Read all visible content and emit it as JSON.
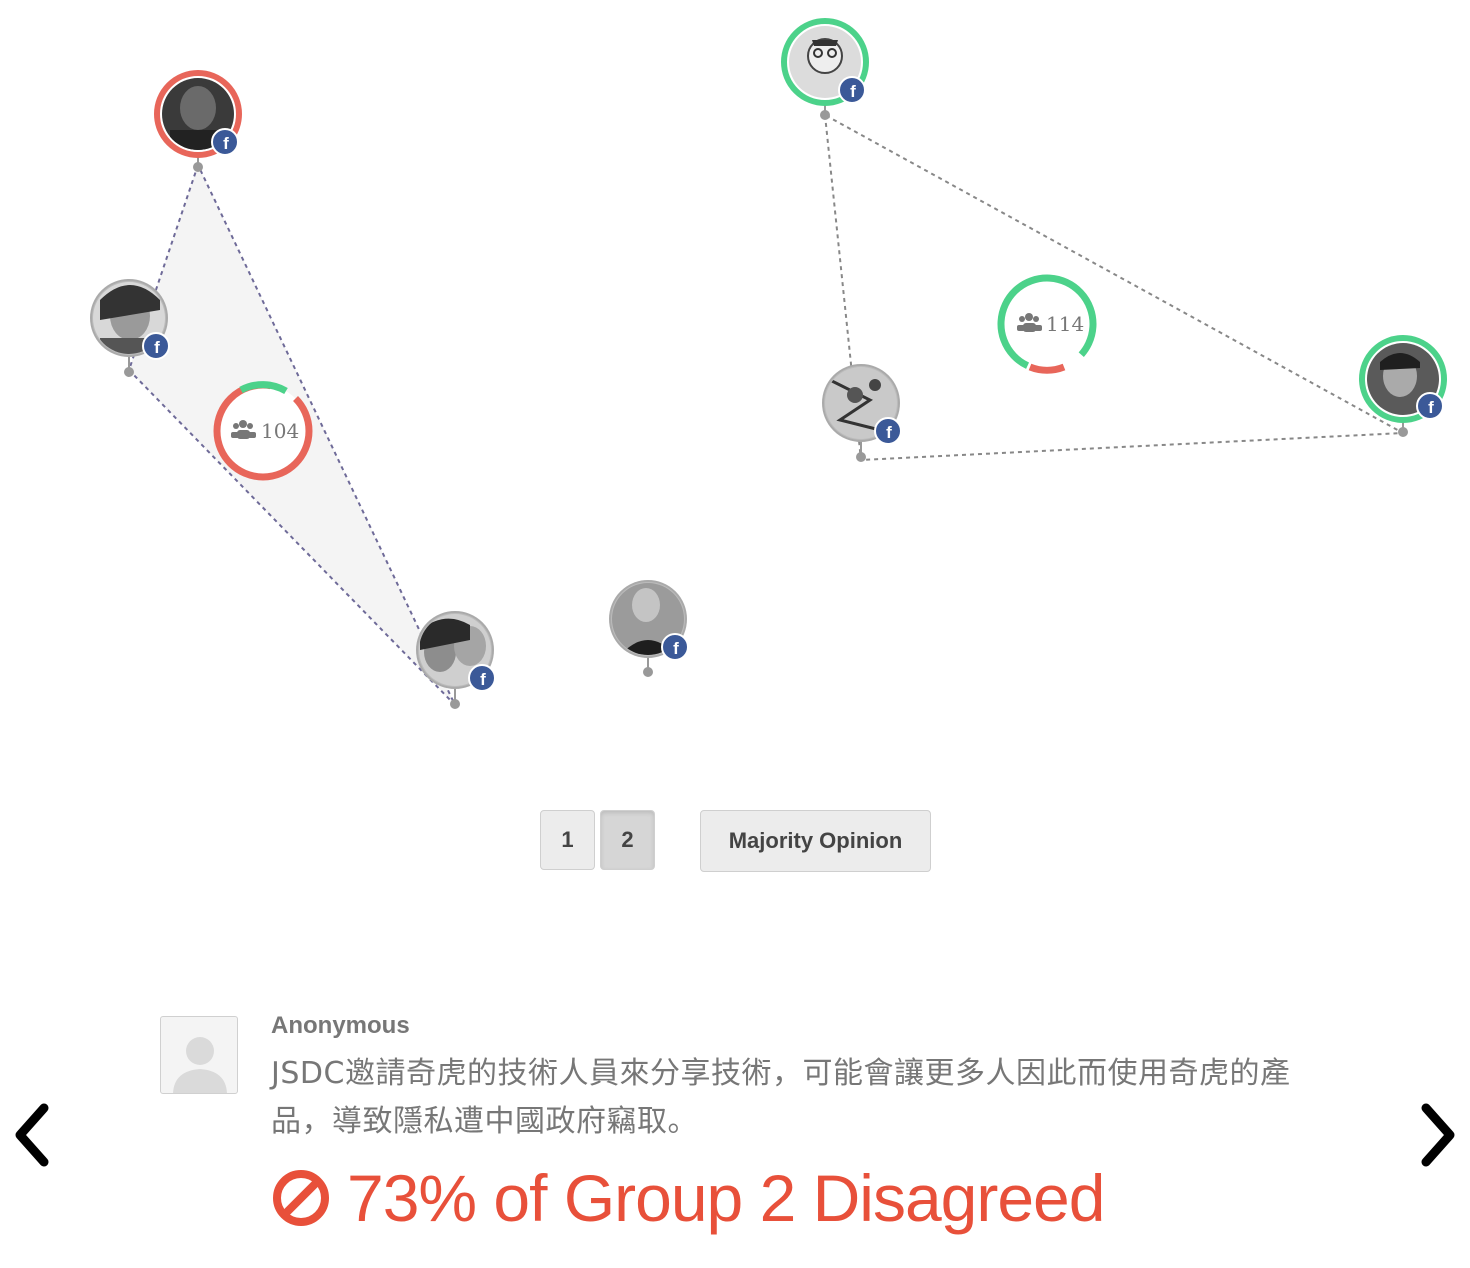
{
  "viz": {
    "groups": [
      {
        "label": "104",
        "agree_color": "#4cd28a",
        "disagree_color": "#e8665a"
      },
      {
        "label": "114",
        "agree_color": "#4cd28a",
        "disagree_color": "#e8665a"
      }
    ],
    "hull_color": "#6e6a98",
    "facebook_icon": "facebook-badge-icon",
    "group_icon": "users-icon"
  },
  "pager": {
    "pages": [
      "1",
      "2"
    ],
    "active_page": "2",
    "majority_label": "Majority Opinion"
  },
  "comment": {
    "author": "Anonymous",
    "text": "JSDC邀請奇虎的技術人員來分享技術，可能會讓更多人因此而使用奇虎的產品，導致隱私遭中國政府竊取。",
    "verdict": "73% of Group 2 Disagreed",
    "verdict_color": "#e8503a",
    "verdict_icon": "disagree-ban-icon"
  },
  "nav": {
    "prev_icon": "chevron-left-icon",
    "next_icon": "chevron-right-icon"
  }
}
